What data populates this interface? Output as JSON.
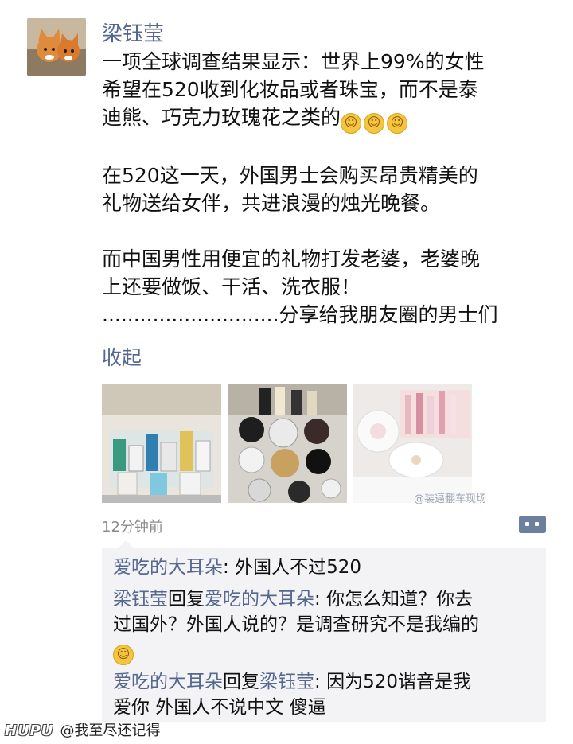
{
  "post": {
    "author": "梁钰莹",
    "avatar_icon": "cat-avatar-icon",
    "lines": [
      "一项全球调查结果显示：世界上99%的女性",
      "希望在520收到化妆品或者珠宝，而不是泰",
      "迪熊、巧克力玫瑰花之类的",
      "在520这一天，外国男士会购买昂贵精美的",
      "礼物送给女伴，共进浪漫的烛光晚餐。",
      "而中国男性用便宜的礼物打发老婆，老婆晚",
      "上还要做饭、干活、洗衣服！",
      "............................分享给我朋友圈的男士们"
    ],
    "emoji_icon": "smile-emoji-icon",
    "collapse_label": "收起",
    "photos": [
      "perfume-photo",
      "cosmetics-shelf-photo",
      "makeup-compact-photo"
    ],
    "timestamp": "12分钟前",
    "watermark": "@装逼翻车现场",
    "comment_button_icon": "comment-dots-icon"
  },
  "comments": [
    {
      "user": "爱吃的大耳朵",
      "sep": ": ",
      "text": "外国人不过520"
    },
    {
      "user": "梁钰莹",
      "reply_word": "回复",
      "reply_to": "爱吃的大耳朵",
      "sep": ": ",
      "text_line1": "你怎么知道？你去",
      "text_line2": "过国外？外国人说的？是调查研究不是我编的"
    },
    {
      "user": "爱吃的大耳朵",
      "reply_word": "回复",
      "reply_to": "梁钰莹",
      "sep": ": ",
      "text_line1": "因为520谐音是我",
      "text_line2": "爱你 外国人不说中文 傻逼"
    }
  ],
  "footer": {
    "brand": "HUPU",
    "handle": "@我至尽还记得"
  },
  "colors": {
    "name_blue": "#56688f",
    "comment_bg": "#f3f3f5",
    "emoji_yellow": "#f5c542"
  }
}
